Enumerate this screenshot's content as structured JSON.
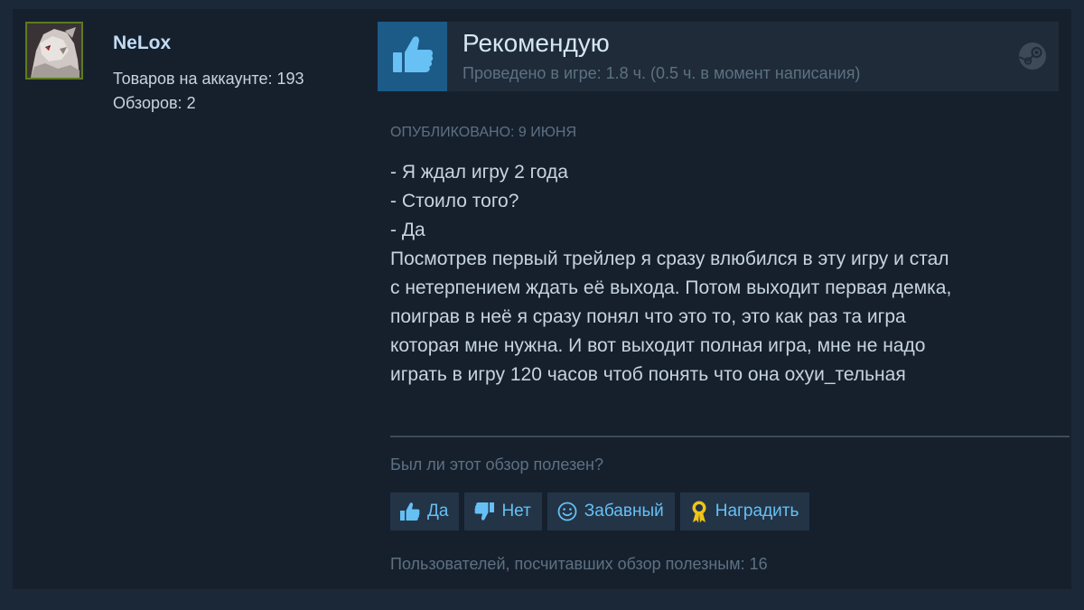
{
  "author": {
    "name": "NeLox",
    "products_label": "Товаров на аккаунте: 193",
    "reviews_label": "Обзоров: 2"
  },
  "review": {
    "verdict": "Рекомендую",
    "playtime": "Проведено в игре: 1.8 ч. (0.5 ч. в момент написания)",
    "posted": "Опубликовано: 9 июня",
    "body_lines": [
      "- Я ждал игру 2 года",
      "- Стоило того?",
      "- Да",
      "Посмотрев первый трейлер я сразу влюбился в эту игру и стал",
      "с нетерпением ждать её выхода. Потом выходит первая демка,",
      "поиграв в неё я сразу понял что это то, это как раз та игра",
      "которая мне нужна. И вот выходит полная игра, мне не надо",
      "играть в игру 120 часов чтоб понять что она охуи_тельная"
    ]
  },
  "rating": {
    "question": "Был ли этот обзор полезен?",
    "buttons": [
      {
        "label": "Да",
        "icon": "thumbs-up-icon"
      },
      {
        "label": "Нет",
        "icon": "thumbs-down-icon"
      },
      {
        "label": "Забавный",
        "icon": "smiley-icon"
      },
      {
        "label": "Наградить",
        "icon": "award-ribbon-icon"
      }
    ],
    "helpful_count": "Пользователей, посчитавших обзор полезным: 16"
  },
  "colors": {
    "page_background": "#1b2838",
    "card_background": "#16202d",
    "recommend_blue": "#1c5a87",
    "link_blue": "#66c0f4",
    "award_gold": "#f0c419",
    "avatar_border_green": "#5a7c1e"
  }
}
